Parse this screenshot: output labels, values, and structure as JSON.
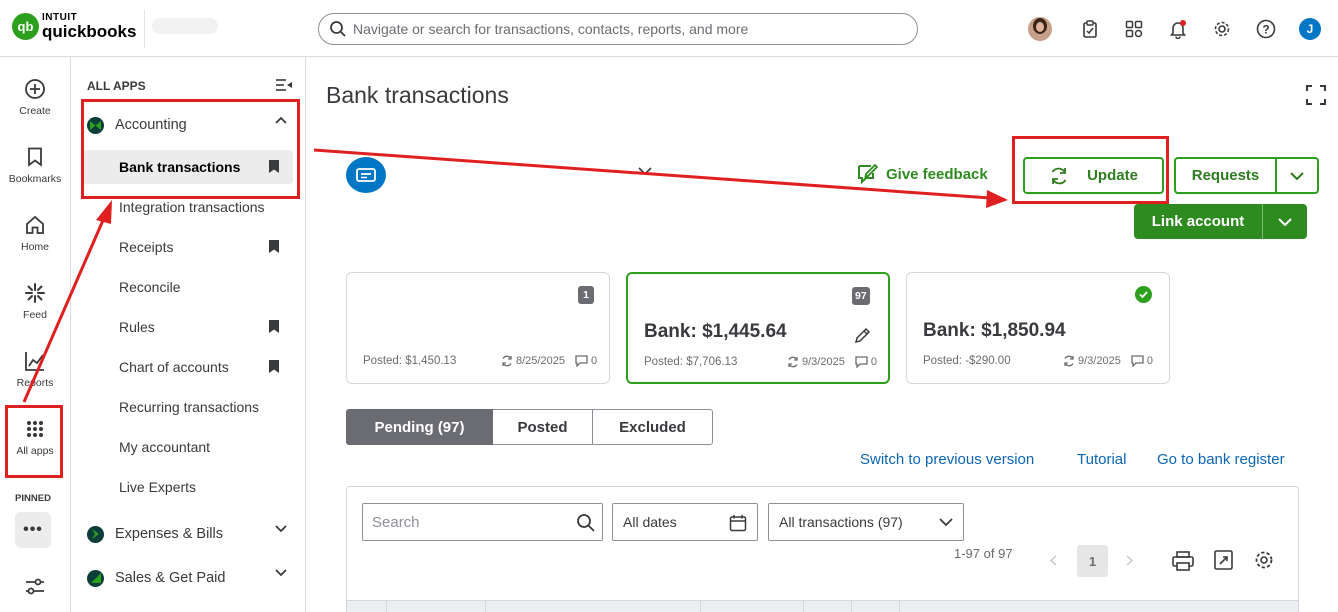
{
  "brand": {
    "line1": "INTUIT",
    "line2": "quickbooks",
    "mark": "qb"
  },
  "search": {
    "placeholder": "Navigate or search for transactions, contacts, reports, and more"
  },
  "topbar_icons": [
    "avatar",
    "clipboard-check-icon",
    "apps-switch-icon",
    "bell-icon",
    "gear-icon",
    "help-icon",
    "user-initial-icon"
  ],
  "user_initial": "J",
  "rail": {
    "items": [
      {
        "label": "Create",
        "icon": "plus-circle-icon"
      },
      {
        "label": "Bookmarks",
        "icon": "bookmark-icon"
      },
      {
        "label": "Home",
        "icon": "home-icon"
      },
      {
        "label": "Feed",
        "icon": "feed-icon"
      },
      {
        "label": "Reports",
        "icon": "chart-icon"
      },
      {
        "label": "All apps",
        "icon": "grid-icon"
      }
    ],
    "pinned_label": "PINNED",
    "more": "•••"
  },
  "apps_panel": {
    "header": "ALL APPS",
    "groups": [
      {
        "label": "Accounting",
        "expanded": true
      },
      {
        "label": "Expenses & Bills",
        "expanded": false
      },
      {
        "label": "Sales & Get Paid",
        "expanded": false
      }
    ],
    "sub_items": [
      {
        "label": "Bank transactions",
        "active": true,
        "bookmarked": true
      },
      {
        "label": "Integration transactions",
        "bookmarked": false
      },
      {
        "label": "Receipts",
        "bookmarked": true
      },
      {
        "label": "Reconcile",
        "bookmarked": false
      },
      {
        "label": "Rules",
        "bookmarked": true
      },
      {
        "label": "Chart of accounts",
        "bookmarked": true
      },
      {
        "label": "Recurring transactions",
        "bookmarked": false
      },
      {
        "label": "My accountant",
        "bookmarked": false
      },
      {
        "label": "Live Experts",
        "bookmarked": false
      }
    ]
  },
  "main": {
    "title": "Bank transactions",
    "feedback": "Give feedback",
    "update": "Update",
    "requests": "Requests",
    "link_account": "Link account",
    "cards": [
      {
        "badge": "1",
        "balance": "",
        "posted": "Posted: $1,450.13",
        "date": "8/25/2025",
        "comments": "0",
        "selected": false
      },
      {
        "badge": "97",
        "balance": "Bank: $1,445.64",
        "posted": "Posted: $7,706.13",
        "date": "9/3/2025",
        "comments": "0",
        "selected": true
      },
      {
        "badge": "",
        "balance": "Bank: $1,850.94",
        "posted": "Posted: -$290.00",
        "date": "9/3/2025",
        "comments": "0",
        "selected": false
      }
    ],
    "tabs": [
      "Pending (97)",
      "Posted",
      "Excluded"
    ],
    "links": [
      "Switch to previous version",
      "Tutorial",
      "Go to bank register"
    ],
    "filters": {
      "search_placeholder": "Search",
      "dates": "All dates",
      "transactions": "All transactions (97)"
    },
    "pager": {
      "range": "1-97 of 97",
      "page": "1"
    }
  },
  "colors": {
    "brand_green": "#2ca01c",
    "blue": "#0077c5",
    "link_blue": "#0d65b2",
    "annotation_red": "#e02020"
  }
}
